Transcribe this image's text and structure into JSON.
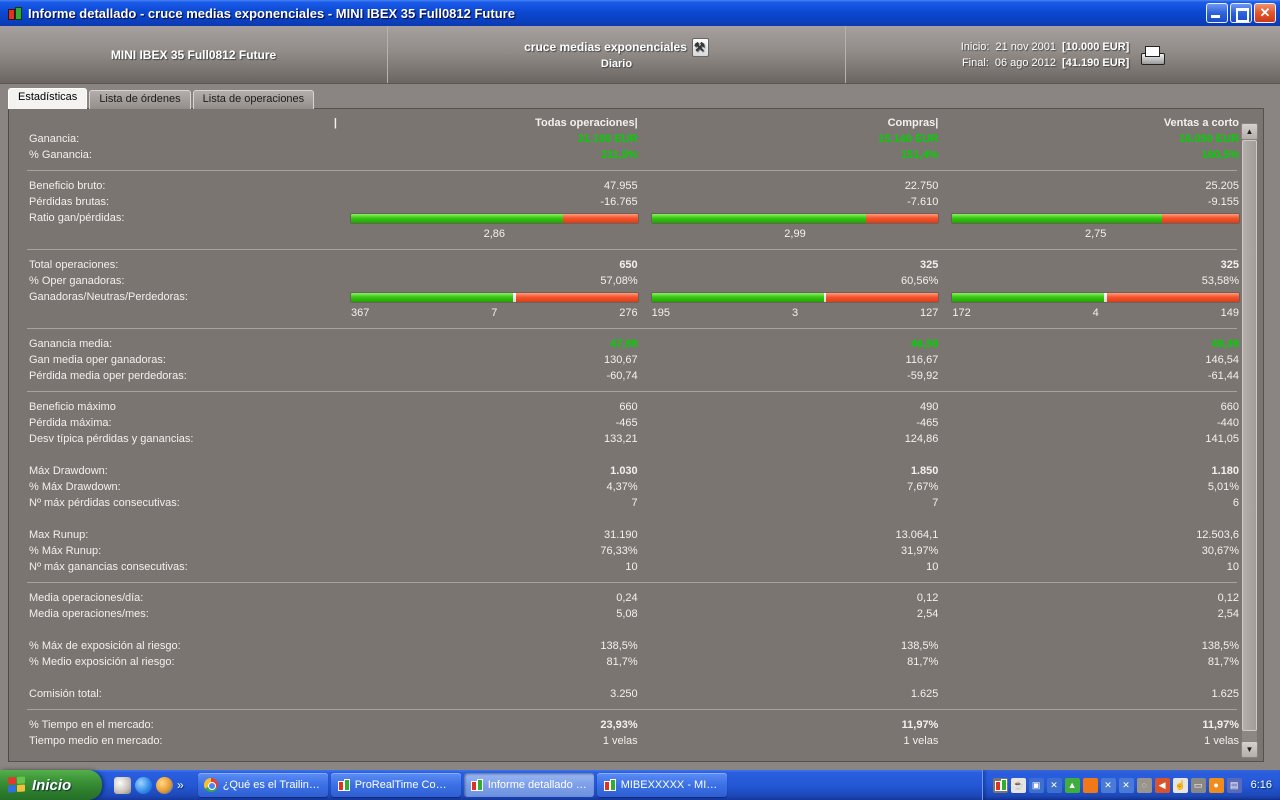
{
  "window": {
    "title": "Informe detallado - cruce medias exponenciales - MINI IBEX 35 Full0812 Future"
  },
  "header": {
    "instrument": "MINI IBEX 35 Full0812 Future",
    "system_name": "cruce medias exponenciales",
    "timeframe": "Diario",
    "inicio_label": "Inicio:",
    "inicio_date": "21 nov 2001",
    "inicio_amount": "[10.000 EUR]",
    "final_label": "Final:",
    "final_date": "06 ago 2012",
    "final_amount": "[41.190 EUR]"
  },
  "tabs": [
    {
      "label": "Estadísticas",
      "active": true
    },
    {
      "label": "Lista de órdenes",
      "active": false
    },
    {
      "label": "Lista de operaciones",
      "active": false
    }
  ],
  "table": {
    "cursor": "|",
    "columns": [
      "Todas operaciones|",
      "Compras|",
      "Ventas a corto"
    ],
    "rows": [
      {
        "label": "Ganancia:",
        "v": [
          "31.190 EUR",
          "15.140 EUR",
          "16.050 EUR"
        ],
        "style": "green"
      },
      {
        "label": "% Ganancia:",
        "v": [
          "311,9%",
          "151,4%",
          "160,5%"
        ],
        "style": "green"
      },
      {
        "label": "Beneficio bruto:",
        "v": [
          "47.955",
          "22.750",
          "25.205"
        ],
        "sep": true
      },
      {
        "label": "Pérdidas brutas:",
        "v": [
          "-16.765",
          "-7.610",
          "-9.155"
        ]
      },
      {
        "label": "Ratio gan/pérdidas:",
        "type": "bar-ratio",
        "green_pct": [
          74.1,
          74.9,
          73.3
        ]
      },
      {
        "label": "",
        "type": "ratio-vals",
        "v": [
          "2,86",
          "2,99",
          "2,75"
        ]
      },
      {
        "label": "Total operaciones:",
        "v": [
          "650",
          "325",
          "325"
        ],
        "style": "bold",
        "sep": true
      },
      {
        "label": "% Oper ganadoras:",
        "v": [
          "57,08%",
          "60,56%",
          "53,58%"
        ]
      },
      {
        "label": "Ganadoras/Neutras/Perdedoras:",
        "type": "bar-gnp",
        "segments": [
          [
            56.5,
            1.1,
            42.4
          ],
          [
            60.0,
            0.9,
            39.1
          ],
          [
            52.9,
            1.2,
            45.9
          ]
        ]
      },
      {
        "label": "",
        "type": "gnp-counts",
        "counts": [
          [
            "367",
            "7",
            "276"
          ],
          [
            "195",
            "3",
            "127"
          ],
          [
            "172",
            "4",
            "149"
          ]
        ]
      },
      {
        "label": "Ganancia media:",
        "v": [
          "47,98",
          "46,58",
          "49,38"
        ],
        "style": "green",
        "sep": true
      },
      {
        "label": "Gan media oper ganadoras:",
        "v": [
          "130,67",
          "116,67",
          "146,54"
        ]
      },
      {
        "label": "Pérdida media oper perdedoras:",
        "v": [
          "-60,74",
          "-59,92",
          "-61,44"
        ]
      },
      {
        "label": "Beneficio máximo",
        "v": [
          "660",
          "490",
          "660"
        ],
        "sep": true
      },
      {
        "label": "Pérdida máxima:",
        "v": [
          "-465",
          "-465",
          "-440"
        ]
      },
      {
        "label": "Desv típica pérdidas y ganancias:",
        "v": [
          "133,21",
          "124,86",
          "141,05"
        ]
      },
      {
        "label": "Máx Drawdown:",
        "v": [
          "1.030",
          "1.850",
          "1.180"
        ],
        "style": "bold",
        "gap": true
      },
      {
        "label": "% Máx Drawdown:",
        "v": [
          "4,37%",
          "7,67%",
          "5,01%"
        ]
      },
      {
        "label": "Nº máx pérdidas consecutivas:",
        "v": [
          "7",
          "7",
          "6"
        ]
      },
      {
        "label": "Max Runup:",
        "v": [
          "31.190",
          "13.064,1",
          "12.503,6"
        ],
        "gap": true
      },
      {
        "label": "% Máx Runup:",
        "v": [
          "76,33%",
          "31,97%",
          "30,67%"
        ]
      },
      {
        "label": "Nº máx ganancias consecutivas:",
        "v": [
          "10",
          "10",
          "10"
        ]
      },
      {
        "label": "Media operaciones/día:",
        "v": [
          "0,24",
          "0,12",
          "0,12"
        ],
        "sep": true
      },
      {
        "label": "Media operaciones/mes:",
        "v": [
          "5,08",
          "2,54",
          "2,54"
        ]
      },
      {
        "label": "% Máx de exposición al riesgo:",
        "v": [
          "138,5%",
          "138,5%",
          "138,5%"
        ],
        "gap": true
      },
      {
        "label": "% Medio exposición al riesgo:",
        "v": [
          "81,7%",
          "81,7%",
          "81,7%"
        ]
      },
      {
        "label": "Comisión total:",
        "v": [
          "3.250",
          "1.625",
          "1.625"
        ],
        "gap": true
      },
      {
        "label": "% Tiempo en el mercado:",
        "v": [
          "23,93%",
          "11,97%",
          "11,97%"
        ],
        "style": "bold",
        "sep": true
      },
      {
        "label": "Tiempo medio en mercado:",
        "v": [
          "1 velas",
          "1 velas",
          "1 velas"
        ]
      }
    ]
  },
  "taskbar": {
    "start_label": "Inicio",
    "quicklaunch_overflow": "»",
    "tasks": [
      {
        "label": "¿Qué es el Trailing St...",
        "icon": "chrome-icon",
        "active": false
      },
      {
        "label": "ProRealTime Complete",
        "icon": "candlestick-icon",
        "active": false
      },
      {
        "label": "Informe detallado - cr...",
        "icon": "candlestick-icon",
        "active": true
      },
      {
        "label": "MIBEXXXXX - MINI IB...",
        "icon": "candlestick-icon",
        "active": false
      }
    ],
    "clock": "6:16",
    "tray_icons": [
      {
        "name": "candlestick-icon",
        "color": "#7b7571",
        "glyph": ""
      },
      {
        "name": "java-icon",
        "color": "#e8e4de",
        "glyph": "☕"
      },
      {
        "name": "network-computers-icon",
        "color": "#3c6fd0",
        "glyph": "▣"
      },
      {
        "name": "network-error-icon",
        "color": "#3c6fd0",
        "glyph": "✕"
      },
      {
        "name": "update-icon",
        "color": "#3fae3f",
        "glyph": "▲"
      },
      {
        "name": "orange-app-icon",
        "color": "#f07818",
        "glyph": ""
      },
      {
        "name": "wireless-error-icon",
        "color": "#4a7ad8",
        "glyph": "✕"
      },
      {
        "name": "network-error2-icon",
        "color": "#4a7ad8",
        "glyph": "✕"
      },
      {
        "name": "speaker-muted-icon",
        "color": "#9a948e",
        "glyph": "◌"
      },
      {
        "name": "volume-icon",
        "color": "#d8542c",
        "glyph": "◀"
      },
      {
        "name": "hand-cursor-icon",
        "color": "#e8e4de",
        "glyph": "☝"
      },
      {
        "name": "monitor-icon",
        "color": "#8a8884",
        "glyph": "▭"
      },
      {
        "name": "firefox-icon",
        "color": "#f08c1c",
        "glyph": "●"
      },
      {
        "name": "notes-icon",
        "color": "#5a6ab8",
        "glyph": "▤"
      }
    ]
  },
  "colors": {
    "profit_green": "#00d200",
    "bar_green": "#39c713",
    "bar_red": "#f4532d",
    "titlebar_blue": "#0c49d2",
    "taskbar_blue": "#2458d6",
    "panel_bg": "#7b7571"
  }
}
